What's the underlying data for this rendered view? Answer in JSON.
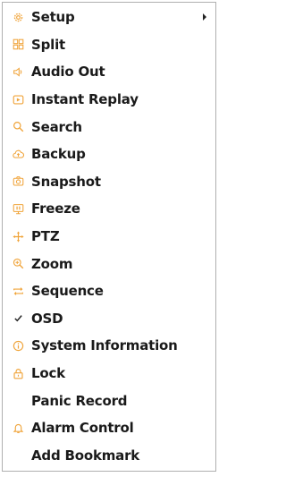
{
  "menu": {
    "items": [
      {
        "label": "Setup",
        "icon": "gear-icon"
      },
      {
        "label": "Split",
        "icon": "grid-icon"
      },
      {
        "label": "Audio Out",
        "icon": "speaker-icon"
      },
      {
        "label": "Instant Replay",
        "icon": "replay-icon"
      },
      {
        "label": "Search",
        "icon": "search-icon"
      },
      {
        "label": "Backup",
        "icon": "backup-icon"
      },
      {
        "label": "Snapshot",
        "icon": "camera-icon"
      },
      {
        "label": "Freeze",
        "icon": "monitor-icon"
      },
      {
        "label": "PTZ",
        "icon": "ptz-icon"
      },
      {
        "label": "Zoom",
        "icon": "zoom-icon"
      },
      {
        "label": "Sequence",
        "icon": "sequence-icon"
      },
      {
        "label": "OSD",
        "icon": "check-icon"
      },
      {
        "label": "System Information",
        "icon": "info-icon"
      },
      {
        "label": "Lock",
        "icon": "lock-icon"
      },
      {
        "label": "Panic Record",
        "icon": ""
      },
      {
        "label": "Alarm Control",
        "icon": "bell-icon"
      },
      {
        "label": "Add Bookmark",
        "icon": ""
      }
    ]
  },
  "colors": {
    "icon": "#f0a43a",
    "text": "#1a1a1a",
    "border": "#b0b0b0",
    "background": "#ffffff"
  }
}
